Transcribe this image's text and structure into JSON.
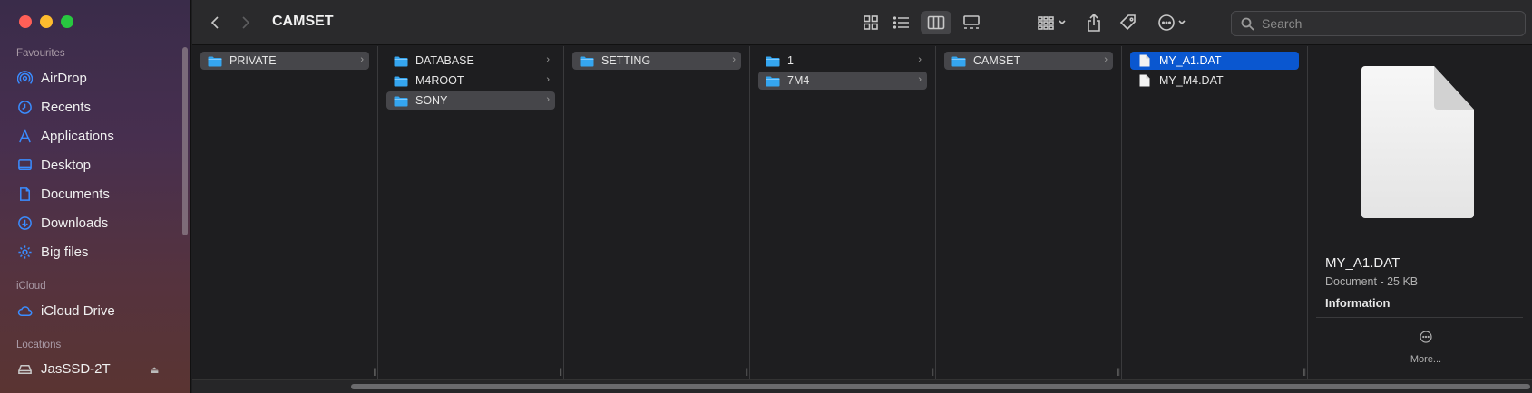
{
  "window": {
    "title": "CAMSET"
  },
  "search": {
    "placeholder": "Search"
  },
  "sidebar": {
    "sections": {
      "favourites": "Favourites",
      "icloud": "iCloud",
      "locations": "Locations"
    },
    "favourites": [
      {
        "label": "AirDrop",
        "icon": "airdrop-icon"
      },
      {
        "label": "Recents",
        "icon": "clock-icon"
      },
      {
        "label": "Applications",
        "icon": "applications-icon"
      },
      {
        "label": "Desktop",
        "icon": "desktop-icon"
      },
      {
        "label": "Documents",
        "icon": "document-icon"
      },
      {
        "label": "Downloads",
        "icon": "download-icon"
      },
      {
        "label": "Big files",
        "icon": "gear-icon"
      }
    ],
    "icloud": [
      {
        "label": "iCloud Drive",
        "icon": "cloud-icon"
      }
    ],
    "locations": [
      {
        "label": "JasSSD-2T",
        "icon": "drive-icon"
      }
    ]
  },
  "columns": [
    {
      "items": [
        {
          "label": "PRIVATE",
          "type": "folder",
          "selected": "gray"
        }
      ]
    },
    {
      "items": [
        {
          "label": "DATABASE",
          "type": "folder"
        },
        {
          "label": "M4ROOT",
          "type": "folder"
        },
        {
          "label": "SONY",
          "type": "folder",
          "selected": "gray"
        }
      ]
    },
    {
      "items": [
        {
          "label": "SETTING",
          "type": "folder",
          "selected": "gray"
        }
      ]
    },
    {
      "items": [
        {
          "label": "1",
          "type": "folder"
        },
        {
          "label": "7M4",
          "type": "folder",
          "selected": "gray"
        }
      ]
    },
    {
      "items": [
        {
          "label": "CAMSET",
          "type": "folder",
          "selected": "gray"
        }
      ]
    },
    {
      "items": [
        {
          "label": "MY_A1.DAT",
          "type": "file",
          "selected": "blue"
        },
        {
          "label": "MY_M4.DAT",
          "type": "file"
        }
      ]
    }
  ],
  "preview": {
    "name": "MY_A1.DAT",
    "kind": "Document - 25 KB",
    "info_heading": "Information",
    "more_label": "More..."
  },
  "colors": {
    "accent": "#0a57d0",
    "icon_blue": "#3a8cff",
    "folder_blue": "#35a6f0"
  }
}
